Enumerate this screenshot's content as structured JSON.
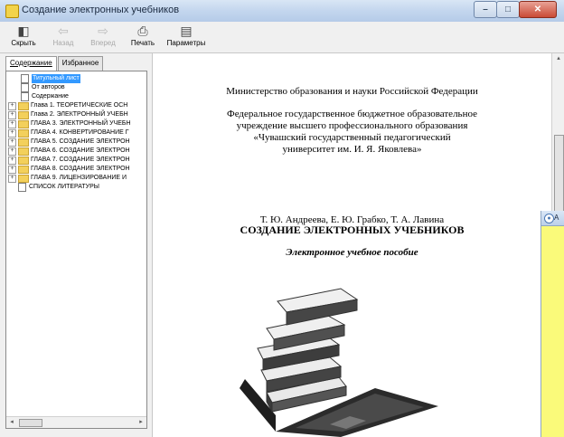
{
  "window": {
    "title": "Создание электронных учебников",
    "controls": {
      "minimize": "–",
      "maximize": "□",
      "close": "✕"
    }
  },
  "toolbar": {
    "hide_label": "Скрыть",
    "back_label": "Назад",
    "forward_label": "Вперед",
    "print_label": "Печать",
    "options_label": "Параметры"
  },
  "nav": {
    "tabs": {
      "contents": "Содержание",
      "favorites": "Избранное"
    },
    "tree": [
      {
        "label": "Титульный лист",
        "kind": "page",
        "selected": true
      },
      {
        "label": "От авторов",
        "kind": "page"
      },
      {
        "label": "Содержание",
        "kind": "page"
      },
      {
        "label": "Глава 1. ТЕОРЕТИЧЕСКИЕ ОСН",
        "kind": "folder"
      },
      {
        "label": "Глава 2. ЭЛЕКТРОННЫЙ УЧЕБН",
        "kind": "folder"
      },
      {
        "label": "ГЛАВА 3. ЭЛЕКТРОННЫЙ УЧЕБН",
        "kind": "folder"
      },
      {
        "label": "ГЛАВА 4. КОНВЕРТИРОВАНИЕ Г",
        "kind": "folder"
      },
      {
        "label": "ГЛАВА 5. СОЗДАНИЕ ЭЛЕКТРОН",
        "kind": "folder"
      },
      {
        "label": "ГЛАВА 6. СОЗДАНИЕ ЭЛЕКТРОН",
        "kind": "folder"
      },
      {
        "label": "ГЛАВА 7. СОЗДАНИЕ ЭЛЕКТРОН",
        "kind": "folder"
      },
      {
        "label": "ГЛАВА 8. СОЗДАНИЕ ЭЛЕКТРОН",
        "kind": "folder"
      },
      {
        "label": "ГЛАВА 9. ЛИЦЕНЗИРОВАНИЕ И",
        "kind": "folder"
      },
      {
        "label": "СПИСОК ЛИТЕРАТУРЫ",
        "kind": "page",
        "top": true
      }
    ]
  },
  "page": {
    "ministry": "Министерство образования и науки Российской Федерации",
    "institution_lines": [
      "Федеральное государственное бюджетное образовательное",
      "учреждение высшего профессионального образования",
      "«Чувашский государственный педагогический",
      "университет им. И. Я. Яковлева»"
    ],
    "authors": "Т. Ю. Андреева, Е. Ю. Грабко, Т. А. Лавина",
    "book_title": "СОЗДАНИЕ ЭЛЕКТРОННЫХ УЧЕБНИКОВ",
    "subtitle": "Электронное учебное пособие"
  },
  "side_window": {
    "title": "A"
  }
}
